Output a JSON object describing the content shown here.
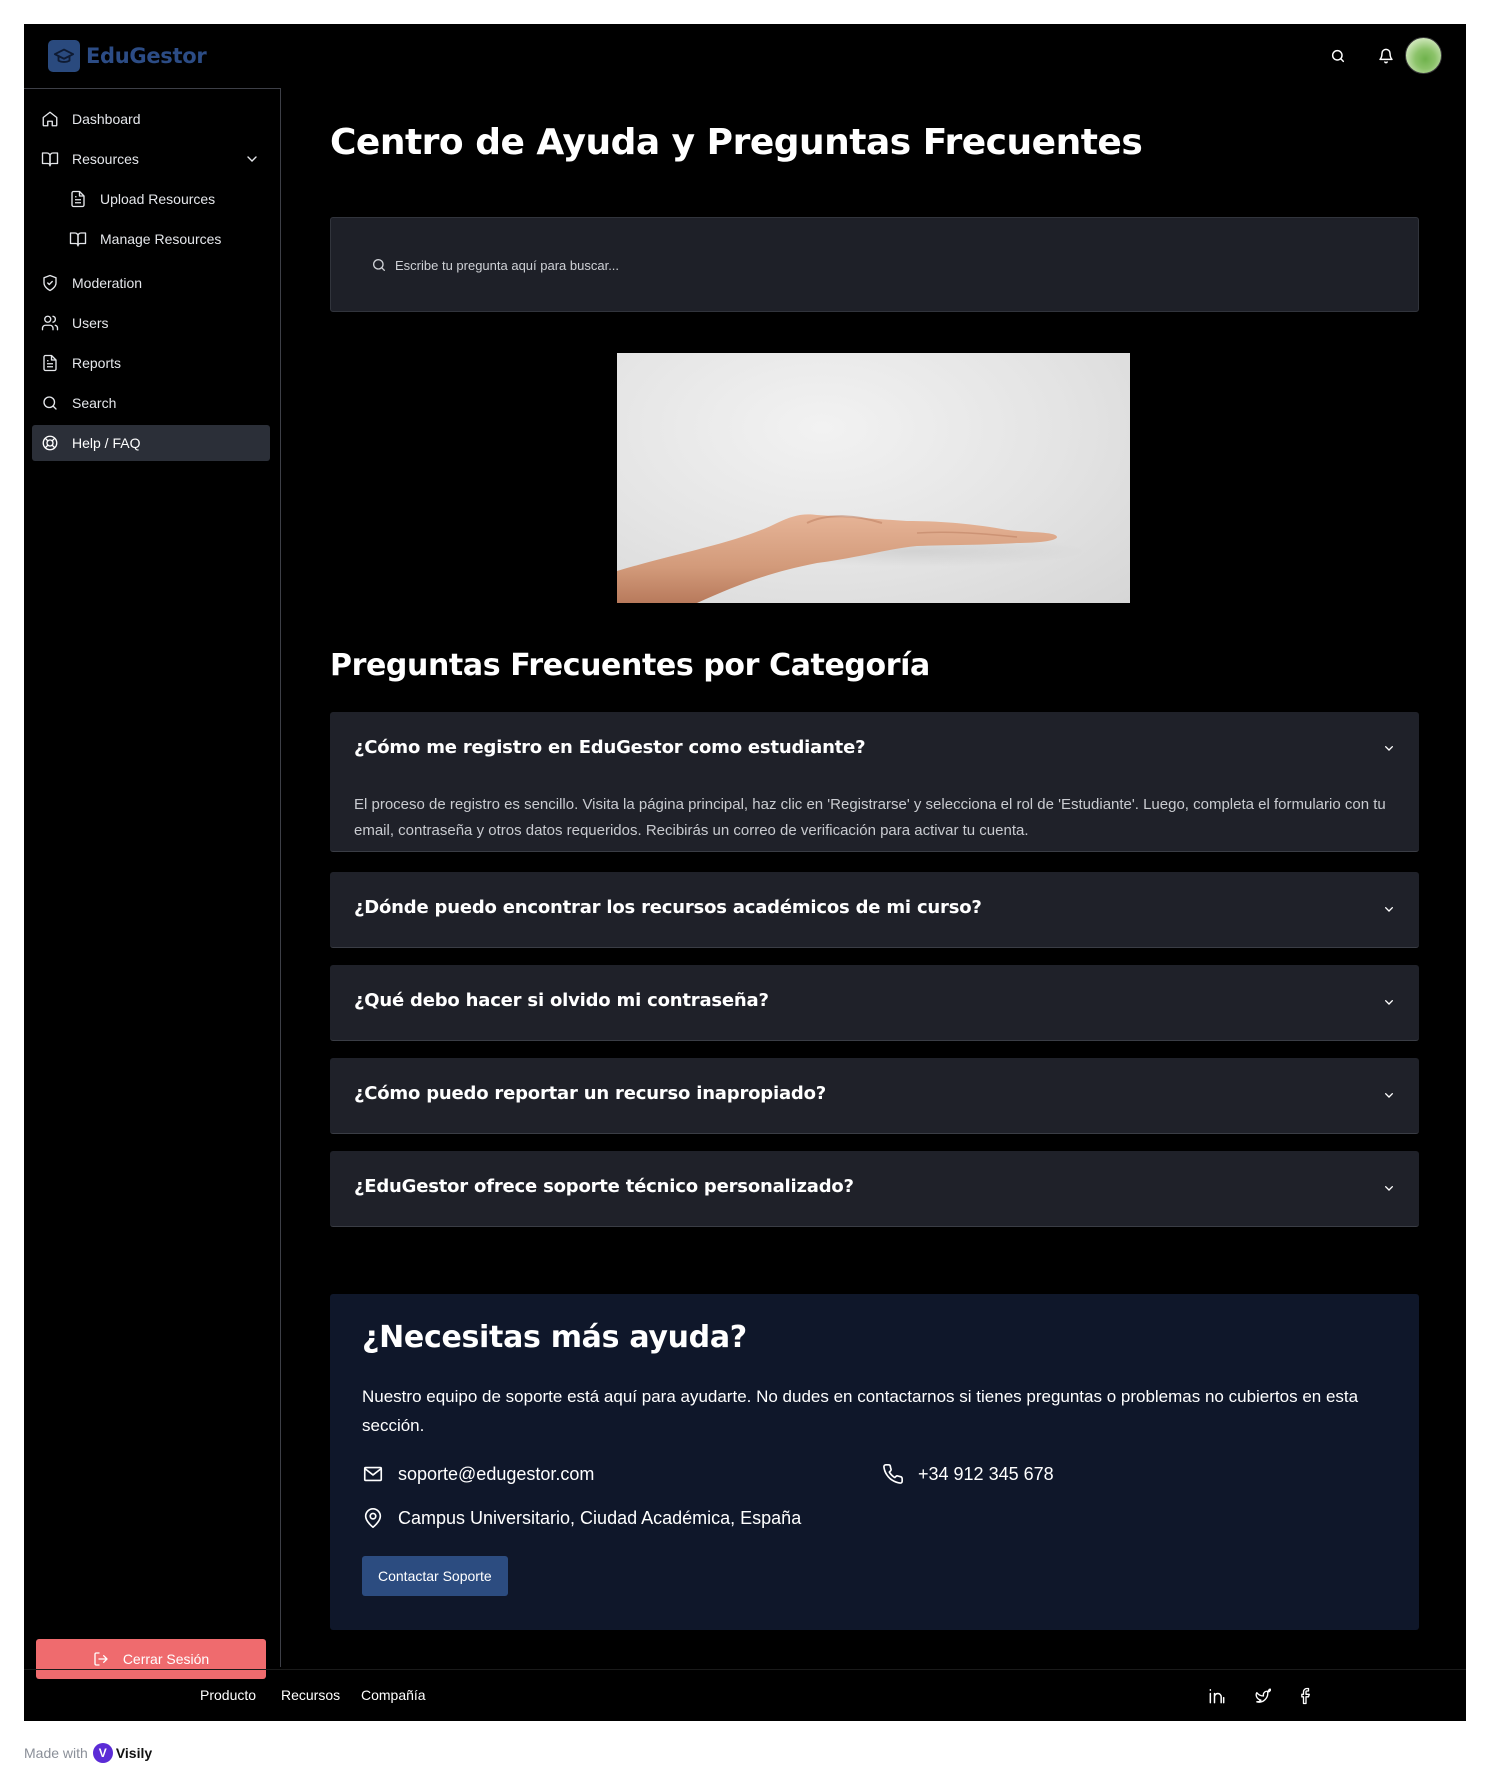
{
  "brand": {
    "name": "EduGestor"
  },
  "colors": {
    "brand": "#2c4c85",
    "logout": "#ef6b6e",
    "help_card": "#0f172a",
    "contact_button": "#2c4c80"
  },
  "header": {
    "icons": [
      "search-icon",
      "bell-icon"
    ],
    "avatar": "user-avatar"
  },
  "sidebar": {
    "items": [
      {
        "label": "Dashboard",
        "icon": "home-icon"
      },
      {
        "label": "Resources",
        "icon": "book-open-icon",
        "expanded": true
      },
      {
        "label": "Upload Resources",
        "icon": "file-text-icon"
      },
      {
        "label": "Manage Resources",
        "icon": "book-open-icon"
      },
      {
        "label": "Moderation",
        "icon": "shield-check-icon"
      },
      {
        "label": "Users",
        "icon": "users-icon"
      },
      {
        "label": "Reports",
        "icon": "file-text-icon"
      },
      {
        "label": "Search",
        "icon": "search-icon"
      },
      {
        "label": "Help / FAQ",
        "icon": "life-buoy-icon",
        "active": true
      }
    ],
    "logout_label": "Cerrar Sesión"
  },
  "main": {
    "title": "Centro de Ayuda y Preguntas Frecuentes",
    "search_placeholder": "Escribe tu pregunta aquí para buscar...",
    "section_title": "Preguntas Frecuentes por Categoría",
    "faqs": [
      {
        "question": "¿Cómo me registro en EduGestor como estudiante?",
        "answer": "El proceso de registro es sencillo. Visita la página principal, haz clic en 'Registrarse' y selecciona el rol de 'Estudiante'. Luego, completa el formulario con tu email, contraseña y otros datos requeridos. Recibirás un correo de verificación para activar tu cuenta.",
        "open": true
      },
      {
        "question": "¿Dónde puedo encontrar los recursos académicos de mi curso?",
        "open": false
      },
      {
        "question": "¿Qué debo hacer si olvido mi contraseña?",
        "open": false
      },
      {
        "question": "¿Cómo puedo reportar un recurso inapropiado?",
        "open": false
      },
      {
        "question": "¿EduGestor ofrece soporte técnico personalizado?",
        "open": false
      }
    ],
    "help": {
      "title": "¿Necesitas más ayuda?",
      "text": "Nuestro equipo de soporte está aquí para ayudarte. No dudes en contactarnos si tienes preguntas o problemas no cubiertos en esta sección.",
      "email": "soporte@edugestor.com",
      "phone": "+34 912 345 678",
      "address": "Campus Universitario, Ciudad Académica, España",
      "button": "Contactar Soporte"
    }
  },
  "footer": {
    "links": [
      "Producto",
      "Recursos",
      "Compañía"
    ],
    "social": [
      "linkedin-icon",
      "twitter-icon",
      "facebook-icon"
    ]
  },
  "made_with": {
    "prefix": "Made with",
    "name": "Visily"
  }
}
